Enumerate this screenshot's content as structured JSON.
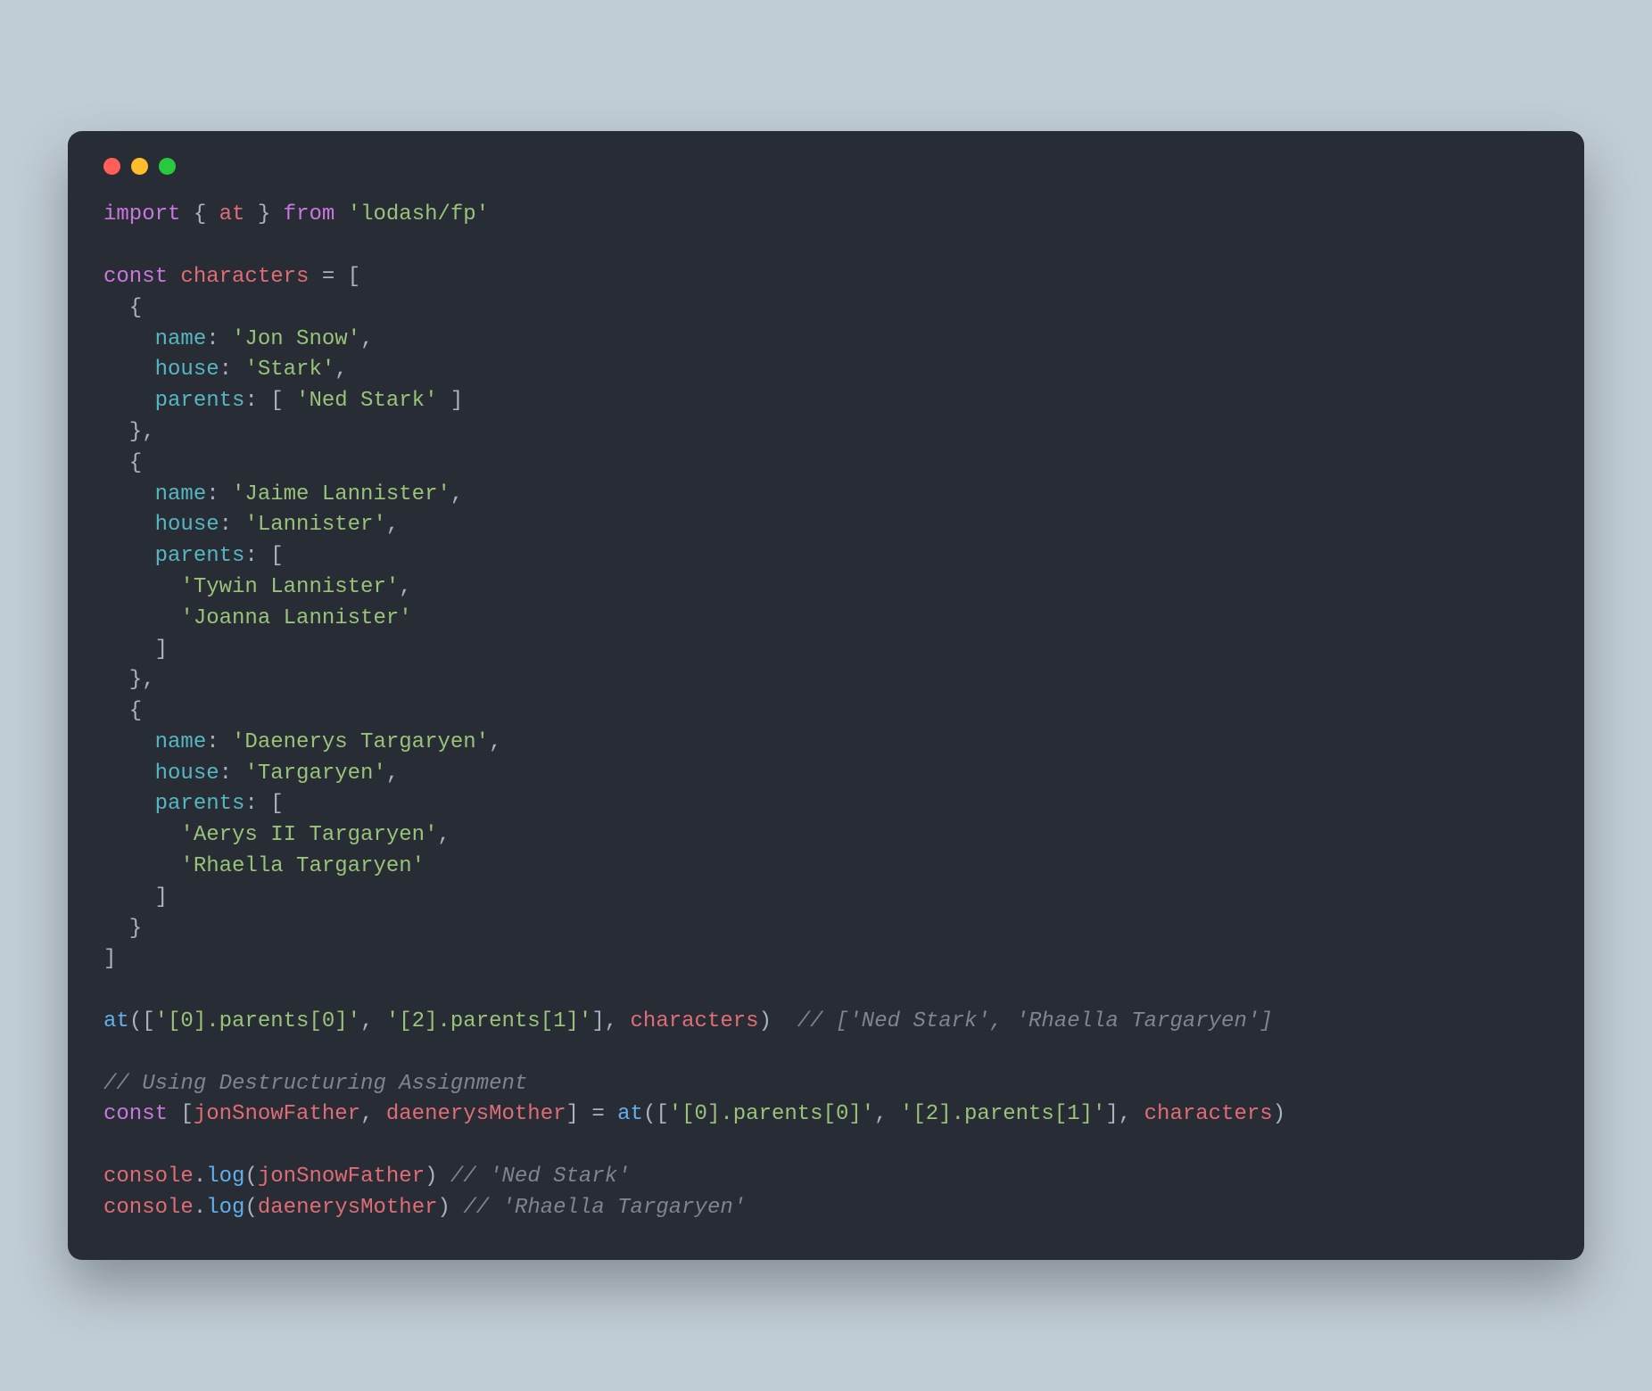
{
  "traffic_lights": [
    "red",
    "yellow",
    "green"
  ],
  "code": {
    "l1": {
      "import": "import",
      "lb": " { ",
      "at": "at",
      "rb": " } ",
      "from": "from",
      "sp": " ",
      "mod": "'lodash/fp'"
    },
    "l3": {
      "const": "const",
      "sp": " ",
      "name": "characters",
      "rest": " = ["
    },
    "l4": "  {",
    "l5": {
      "pad": "    ",
      "key": "name",
      "col": ": ",
      "val": "'Jon Snow'",
      "c": ","
    },
    "l6": {
      "pad": "    ",
      "key": "house",
      "col": ": ",
      "val": "'Stark'",
      "c": ","
    },
    "l7": {
      "pad": "    ",
      "key": "parents",
      "col": ": [ ",
      "val": "'Ned Stark'",
      "end": " ]"
    },
    "l8": "  },",
    "l9": "  {",
    "l10": {
      "pad": "    ",
      "key": "name",
      "col": ": ",
      "val": "'Jaime Lannister'",
      "c": ","
    },
    "l11": {
      "pad": "    ",
      "key": "house",
      "col": ": ",
      "val": "'Lannister'",
      "c": ","
    },
    "l12": {
      "pad": "    ",
      "key": "parents",
      "col": ": ["
    },
    "l13": {
      "pad": "      ",
      "val": "'Tywin Lannister'",
      "c": ","
    },
    "l14": {
      "pad": "      ",
      "val": "'Joanna Lannister'"
    },
    "l15": "    ]",
    "l16": "  },",
    "l17": "  {",
    "l18": {
      "pad": "    ",
      "key": "name",
      "col": ": ",
      "val": "'Daenerys Targaryen'",
      "c": ","
    },
    "l19": {
      "pad": "    ",
      "key": "house",
      "col": ": ",
      "val": "'Targaryen'",
      "c": ","
    },
    "l20": {
      "pad": "    ",
      "key": "parents",
      "col": ": ["
    },
    "l21": {
      "pad": "      ",
      "val": "'Aerys II Targaryen'",
      "c": ","
    },
    "l22": {
      "pad": "      ",
      "val": "'Rhaella Targaryen'"
    },
    "l23": "    ]",
    "l24": "  }",
    "l25": "]",
    "l27": {
      "fn": "at",
      "a": "([",
      "s1": "'[0].parents[0]'",
      "c1": ", ",
      "s2": "'[2].parents[1]'",
      "b": "], ",
      "arg": "characters",
      "close": ")  ",
      "cm": "// ['Ned Stark', 'Rhaella Targaryen']"
    },
    "l29": {
      "cm": "// Using Destructuring Assignment"
    },
    "l30": {
      "const": "const",
      "a": " [",
      "v1": "jonSnowFather",
      "c1": ", ",
      "v2": "daenerysMother",
      "b": "] = ",
      "fn": "at",
      "c": "([",
      "s1": "'[0].parents[0]'",
      "c2": ", ",
      "s2": "'[2].parents[1]'",
      "d": "], ",
      "arg": "characters",
      "close": ")"
    },
    "l32": {
      "obj": "console",
      "dot": ".",
      "fn": "log",
      "a": "(",
      "arg": "jonSnowFather",
      "b": ") ",
      "cm": "// 'Ned Stark'"
    },
    "l33": {
      "obj": "console",
      "dot": ".",
      "fn": "log",
      "a": "(",
      "arg": "daenerysMother",
      "b": ") ",
      "cm": "// 'Rhaella Targaryen'"
    }
  }
}
